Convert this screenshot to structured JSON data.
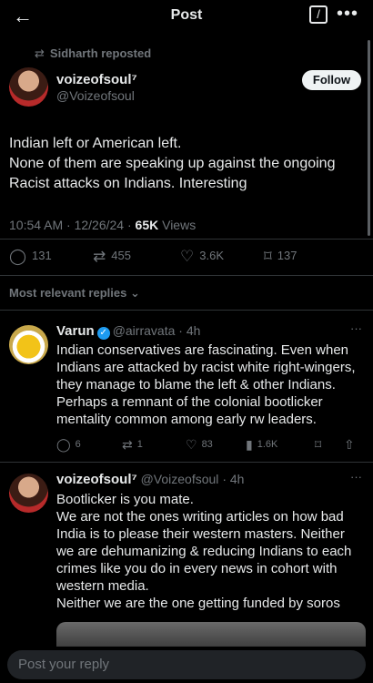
{
  "header": {
    "title": "Post",
    "back": "←",
    "edit_icon": "edit-icon",
    "more": "•••"
  },
  "post": {
    "reposted_by": "Sidharth reposted",
    "author_name": "voizeofsoul⁷",
    "author_handle": "@Voizeofsoul",
    "follow_label": "Follow",
    "text": [
      "Indian left or American left.",
      "None of them are speaking up against the ongoing",
      "Racist attacks on Indians. Interesting"
    ],
    "time": "10:54 AM · 12/26/24 · ",
    "views_count": "65K",
    "views_label": " Views",
    "stats": {
      "replies": "131",
      "reposts": "455",
      "likes": "3.6K",
      "bookmarks": "137"
    }
  },
  "sort_label": "Most relevant replies",
  "replies": [
    {
      "name": "Varun",
      "handle": "@airravata",
      "age": "· 4h",
      "text": [
        "Indian conservatives are fascinating. Even when",
        "Indians are attacked by racist white right-wingers,",
        "they manage to blame the left & other Indians.",
        "Perhaps a remnant of the colonial bootlicker",
        "mentality common among early rw leaders."
      ],
      "stats": {
        "replies": "6",
        "reposts": "1",
        "likes": "83",
        "views": "1.6K"
      }
    },
    {
      "name": "voizeofsoul⁷",
      "handle": "@Voizeofsoul",
      "age": "· 4h",
      "text": [
        "Bootlicker is you mate.",
        "We are not the ones writing articles on how bad",
        "India is to please their western masters. Neither",
        "we are dehumanizing & reducing Indians to each",
        "crimes like you do in every news in cohort with",
        "western media.",
        "Neither we are the one getting funded by soros"
      ]
    }
  ],
  "composer": {
    "placeholder": "Post your reply"
  }
}
